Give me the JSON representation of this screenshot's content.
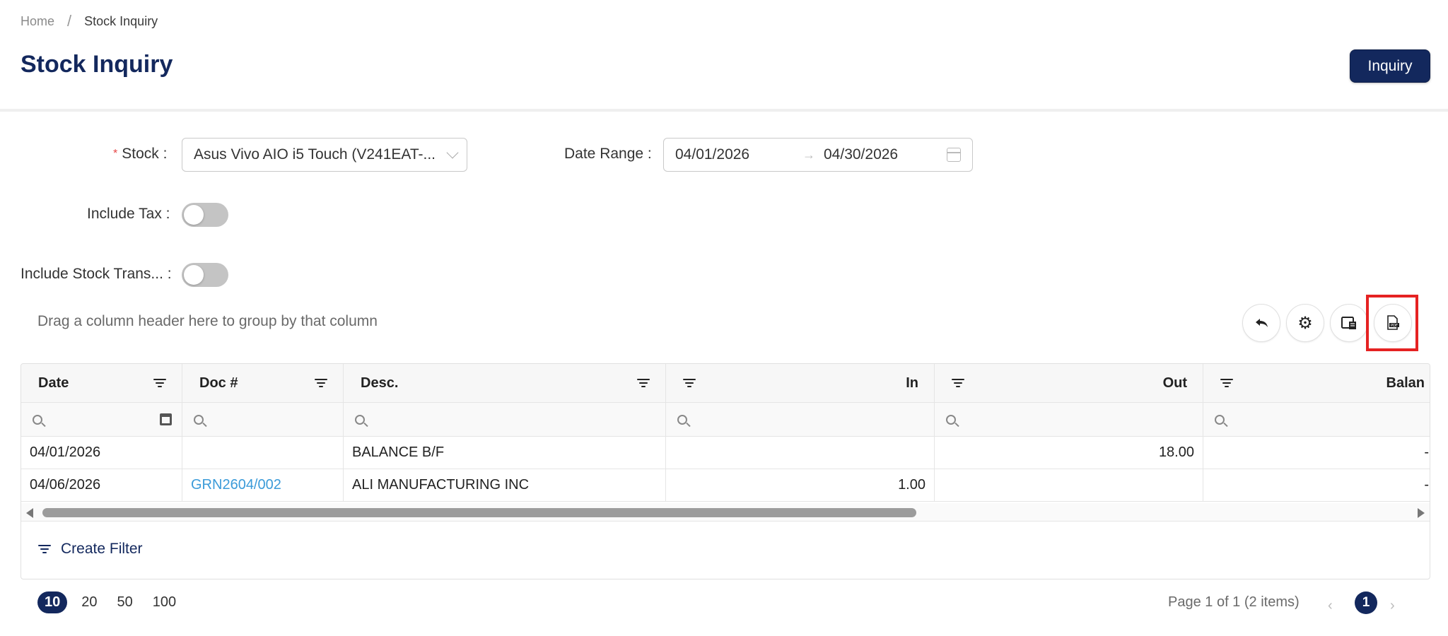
{
  "breadcrumb": {
    "home": "Home",
    "separator": "/",
    "current": "Stock Inquiry"
  },
  "page": {
    "title": "Stock Inquiry",
    "inquiry_button": "Inquiry"
  },
  "form": {
    "required_mark": "*",
    "stock_label": "Stock :",
    "stock_value": "Asus Vivo AIO i5 Touch (V241EAT-...",
    "date_range_label": "Date Range :",
    "date_from": "04/01/2026",
    "date_arrow": "→",
    "date_to": "04/30/2026",
    "include_tax_label": "Include Tax :",
    "include_tax_on": false,
    "include_stock_trans_label": "Include Stock Trans... :",
    "include_stock_trans_on": false
  },
  "grid": {
    "group_hint": "Drag a column header here to group by that column",
    "columns": [
      "Date",
      "Doc #",
      "Desc.",
      "In",
      "Out",
      "Balan"
    ],
    "rows": [
      {
        "date": "04/01/2026",
        "doc": "",
        "desc": "BALANCE B/F",
        "in": "",
        "out": "18.00",
        "balance": "-"
      },
      {
        "date": "04/06/2026",
        "doc": "GRN2604/002",
        "desc": "ALI MANUFACTURING INC",
        "in": "1.00",
        "out": "",
        "balance": "-"
      }
    ],
    "create_filter": "Create Filter",
    "toolbar_icons": [
      "undo-icon",
      "gear-icon",
      "column-chooser-icon",
      "export-pdf-icon"
    ]
  },
  "pager": {
    "sizes": [
      "10",
      "20",
      "50",
      "100"
    ],
    "active_size": "10",
    "info": "Page 1 of 1 (2 items)",
    "prev": "‹",
    "current": "1",
    "next": "›"
  },
  "colors": {
    "brand": "#13285d",
    "link": "#3b9bd9",
    "highlight": "#e52222"
  }
}
